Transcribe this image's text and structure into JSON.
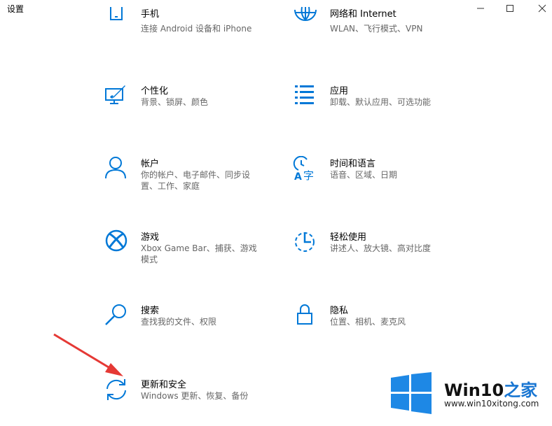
{
  "window": {
    "title": "设置"
  },
  "items": [
    {
      "name": "手机",
      "desc": "连接 Android 设备和 iPhone",
      "icon": "phone-icon"
    },
    {
      "name": "网络和 Internet",
      "desc": "WLAN、飞行模式、VPN",
      "icon": "globe-icon"
    },
    {
      "name": "个性化",
      "desc": "背景、锁屏、颜色",
      "icon": "paint-monitor-icon"
    },
    {
      "name": "应用",
      "desc": "卸载、默认应用、可选功能",
      "icon": "apps-list-icon"
    },
    {
      "name": "帐户",
      "desc": "你的帐户、电子邮件、同步设置、工作、家庭",
      "icon": "person-icon"
    },
    {
      "name": "时间和语言",
      "desc": "语音、区域、日期",
      "icon": "time-language-icon"
    },
    {
      "name": "游戏",
      "desc": "Xbox Game Bar、捕获、游戏模式",
      "icon": "xbox-icon"
    },
    {
      "name": "轻松使用",
      "desc": "讲述人、放大镜、高对比度",
      "icon": "ease-of-access-icon"
    },
    {
      "name": "搜索",
      "desc": "查找我的文件、权限",
      "icon": "search-icon"
    },
    {
      "name": "隐私",
      "desc": "位置、相机、麦克风",
      "icon": "lock-icon"
    },
    {
      "name": "更新和安全",
      "desc": "Windows 更新、恢复、备份",
      "icon": "sync-icon"
    }
  ],
  "watermark": {
    "brand_a": "Win10",
    "brand_b": "之家",
    "site": "www.win10xitong.com"
  },
  "colors": {
    "accent": "#0078d7",
    "arrow": "#e53935"
  }
}
